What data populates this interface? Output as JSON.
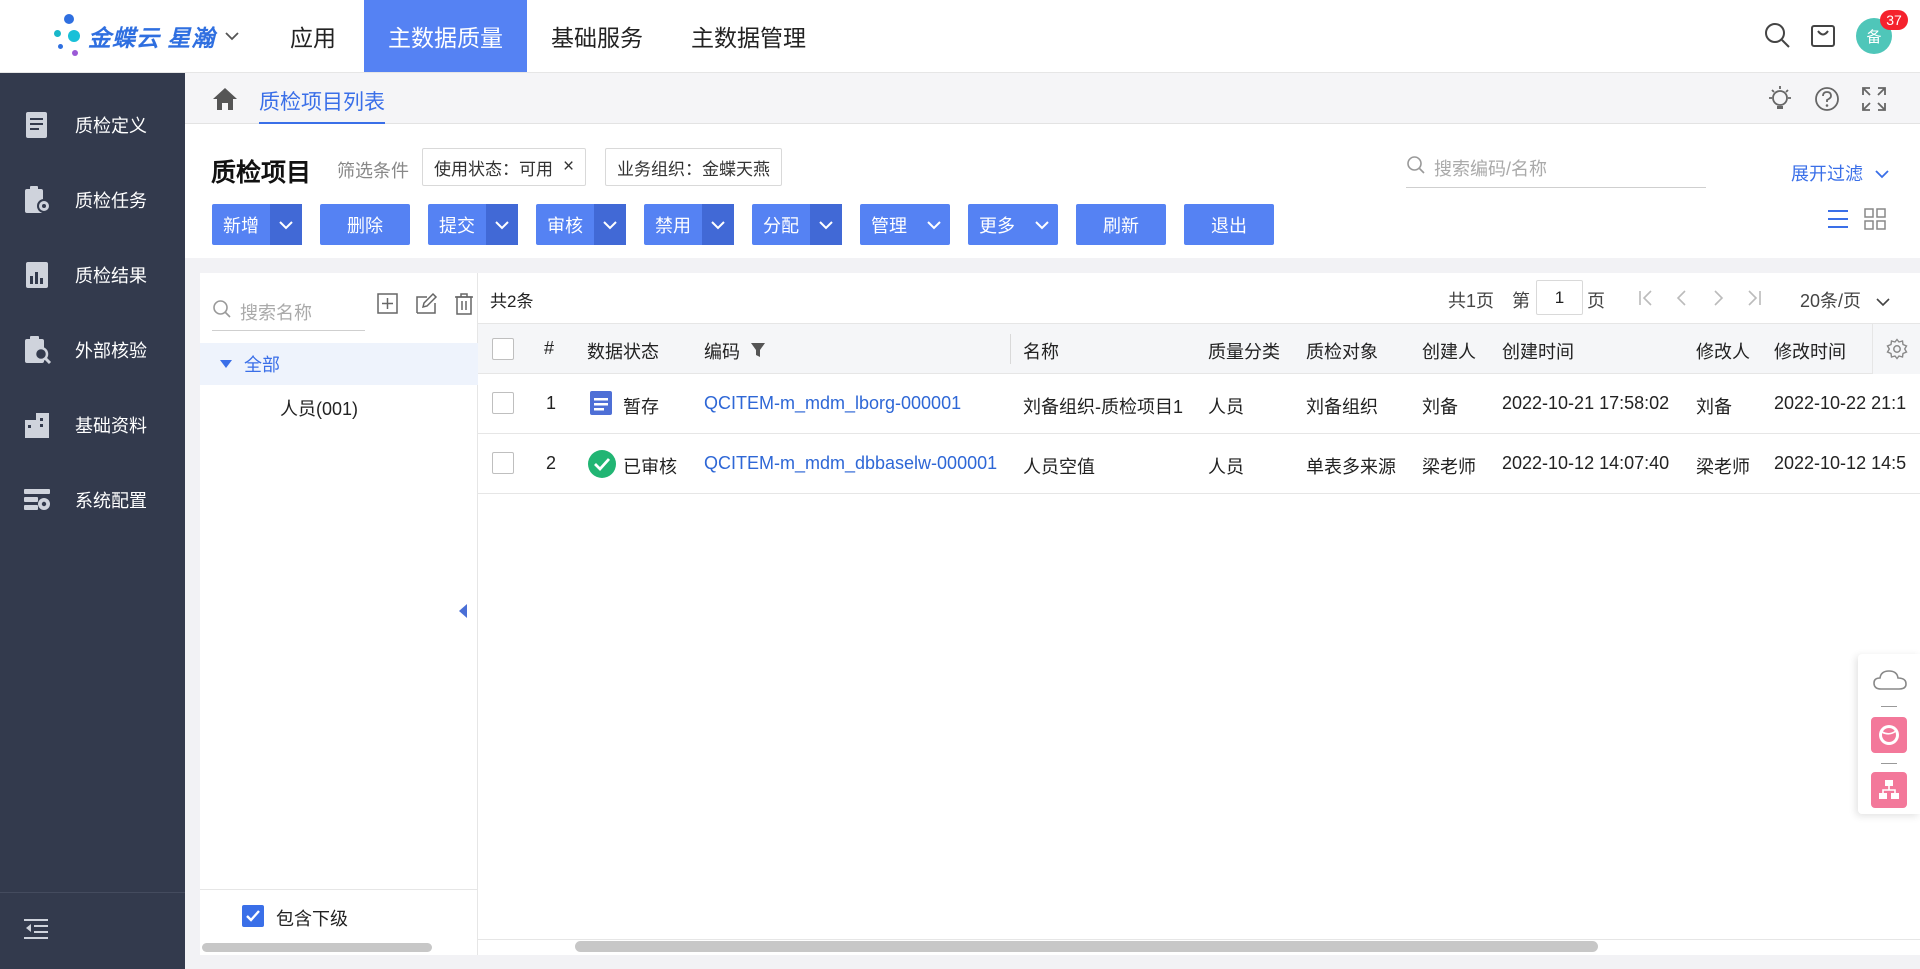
{
  "app": {
    "logo_text": "金蝶云 星瀚",
    "notification_count": "37",
    "avatar_text": "备"
  },
  "topnav": [
    {
      "label": "应用",
      "active": false
    },
    {
      "label": "主数据质量",
      "active": true
    },
    {
      "label": "基础服务",
      "active": false
    },
    {
      "label": "主数据管理",
      "active": false
    }
  ],
  "sidebar": {
    "items": [
      {
        "label": "质检定义",
        "icon": "book-icon"
      },
      {
        "label": "质检任务",
        "icon": "task-gear-icon"
      },
      {
        "label": "质检结果",
        "icon": "result-doc-icon"
      },
      {
        "label": "外部核验",
        "icon": "clipboard-search-icon"
      },
      {
        "label": "基础资料",
        "icon": "building-icon"
      },
      {
        "label": "系统配置",
        "icon": "config-gear-icon"
      }
    ]
  },
  "tab": {
    "label": "质检项目列表"
  },
  "header": {
    "title": "质检项目",
    "filter_label": "筛选条件",
    "chips": [
      "使用状态：可用",
      "业务组织：金蝶天燕"
    ],
    "search_placeholder": "搜索编码/名称",
    "expand_filter": "展开过滤"
  },
  "toolbar": [
    {
      "label": "新增",
      "dropdown": true
    },
    {
      "label": "删除",
      "dropdown": false
    },
    {
      "label": "提交",
      "dropdown": true
    },
    {
      "label": "审核",
      "dropdown": true
    },
    {
      "label": "禁用",
      "dropdown": true
    },
    {
      "label": "分配",
      "dropdown": true
    },
    {
      "label": "管理",
      "dropdown": true
    },
    {
      "label": "更多",
      "dropdown": true
    },
    {
      "label": "刷新",
      "dropdown": false
    },
    {
      "label": "退出",
      "dropdown": false
    }
  ],
  "tree": {
    "search_placeholder": "搜索名称",
    "root": "全部",
    "child": "人员(001)",
    "include_sub": "包含下级"
  },
  "pager": {
    "total": "共2条",
    "pages": "共1页",
    "page_prefix": "第",
    "current_page": "1",
    "page_suffix": "页",
    "page_size": "20条/页"
  },
  "table": {
    "columns": [
      "#",
      "数据状态",
      "编码",
      "名称",
      "质量分类",
      "质检对象",
      "创建人",
      "创建时间",
      "修改人",
      "修改时间"
    ],
    "rows": [
      {
        "no": "1",
        "status": "暂存",
        "status_icon": "draft-doc-icon",
        "code": "QCITEM-m_mdm_lborg-000001",
        "name": "刘备组织-质检项目1",
        "category": "人员",
        "object": "刘备组织",
        "creator": "刘备",
        "created": "2022-10-21 17:58:02",
        "modifier": "刘备",
        "modified": "2022-10-22 21:1"
      },
      {
        "no": "2",
        "status": "已审核",
        "status_icon": "check-circle-icon",
        "code": "QCITEM-m_mdm_dbbaselw-000001",
        "name": "人员空值",
        "category": "人员",
        "object": "单表多来源",
        "creator": "梁老师",
        "created": "2022-10-12 14:07:40",
        "modifier": "梁老师",
        "modified": "2022-10-12 14:5"
      }
    ]
  },
  "colors": {
    "primary": "#5582f3",
    "primary_dark": "#4169d6",
    "sidebar_bg": "#333a4d",
    "link": "#2e67d6",
    "approved": "#21b573",
    "draft": "#4e6fd6"
  }
}
